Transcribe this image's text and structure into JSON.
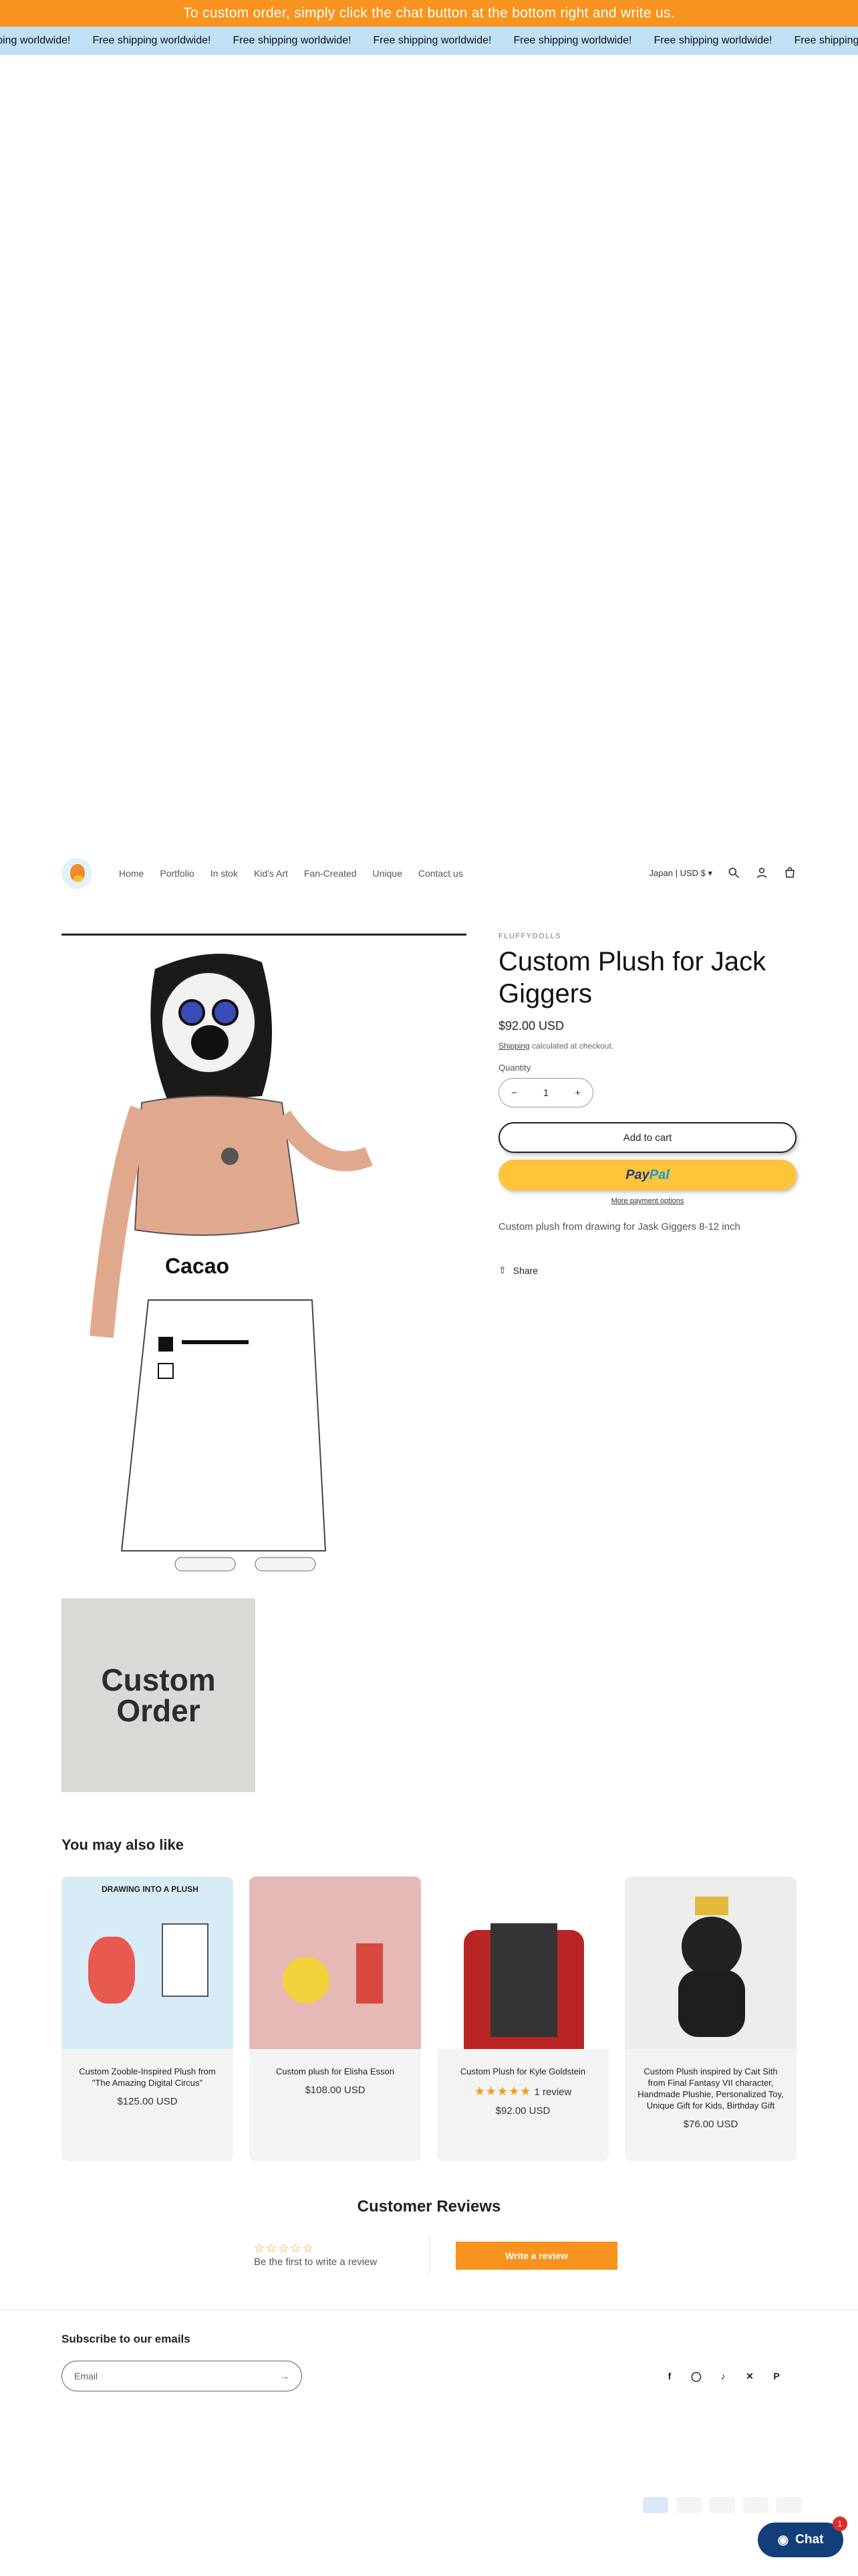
{
  "announcement": "To custom order, simply click the chat button at the bottom right and write us.",
  "marquee": {
    "items": [
      "Free shipping worldwide!",
      "Free shipping worldwide!",
      "Free shipping worldwide!",
      "Free shipping worldwide!",
      "Free shipping worldwide!",
      "Free shipping worldwide!",
      "Free shipping worldwide!"
    ]
  },
  "header": {
    "nav": [
      "Home",
      "Portfolio",
      "In stok",
      "Kid's Art",
      "Fan-Created",
      "Unique",
      "Contact us"
    ],
    "currency": "Japan | USD $"
  },
  "product": {
    "vendor": "FLUFFYDOLLS",
    "title": "Custom Plush for Jack Giggers",
    "price": "$92.00 USD",
    "shipping_link": "Shipping",
    "shipping_note": "calculated at checkout.",
    "quantity_label": "Quantity",
    "quantity": "1",
    "add_to_cart": "Add to cart",
    "paypal_a": "Pay",
    "paypal_b": "Pal",
    "more_payment": "More payment options",
    "description": "Custom plush from drawing for Jask Giggers 8-12 inch",
    "share": "Share",
    "main_image_text": "Cacao",
    "thumb_line1": "Custom",
    "thumb_line2": "Order"
  },
  "related": {
    "heading": "You may also like",
    "items": [
      {
        "name": "Custom Zooble-Inspired Plush from \"The Amazing Digital Circus\"",
        "price": "$125.00 USD",
        "image_text": "DRAWING INTO A PLUSH"
      },
      {
        "name": "Custom plush for Elisha Esson",
        "price": "$108.00 USD"
      },
      {
        "name": "Custom Plush for Kyle Goldstein",
        "price": "$92.00 USD",
        "rating": 5,
        "reviews": "1 review"
      },
      {
        "name": "Custom Plush inspired by Cait Sith from Final Fantasy VII character, Handmade Plushie, Personalized Toy, Unique Gift for Kids, Birthday Gift",
        "price": "$76.00 USD"
      }
    ]
  },
  "reviews": {
    "title": "Customer Reviews",
    "empty": "Be the first to write a review",
    "button": "Write a review"
  },
  "footer": {
    "subscribe": "Subscribe to our emails",
    "email_placeholder": "Email"
  },
  "chat": {
    "label": "Chat",
    "badge": "1"
  },
  "colors": {
    "announcement": "#f7931e",
    "marquee": "#bfe0f5",
    "paypal": "#ffc439",
    "chat": "#123e7a"
  }
}
